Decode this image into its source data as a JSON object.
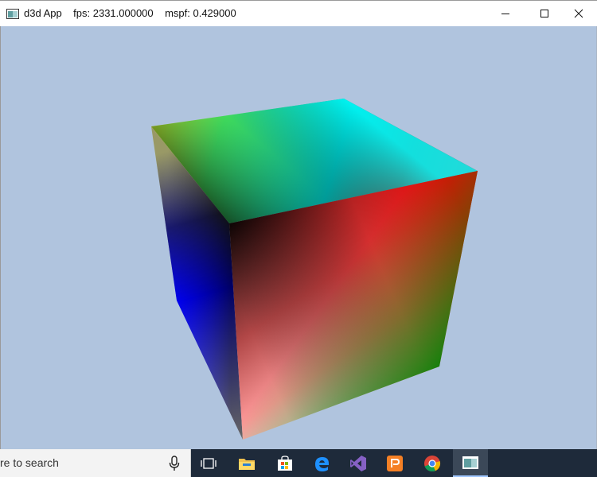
{
  "window": {
    "title": "d3d App    fps: 2331.000000    mspf: 0.429000"
  },
  "caption_buttons": {
    "minimize": "minimize-icon",
    "maximize": "maximize-icon",
    "close": "close-icon"
  },
  "scene": {
    "background_color": "#b0c4de",
    "cube_vertex_colors": [
      "#ffff00",
      "#00ffff",
      "#ff0000",
      "#000000",
      "#0000ff",
      "#ffffff",
      "#008000"
    ]
  },
  "taskbar": {
    "search_placeholder": "re to search",
    "apps": [
      "task-view-icon",
      "file-explorer-icon",
      "store-icon",
      "edge-icon",
      "visual-studio-icon",
      "office-icon",
      "chrome-icon",
      "d3d-app-icon"
    ]
  }
}
